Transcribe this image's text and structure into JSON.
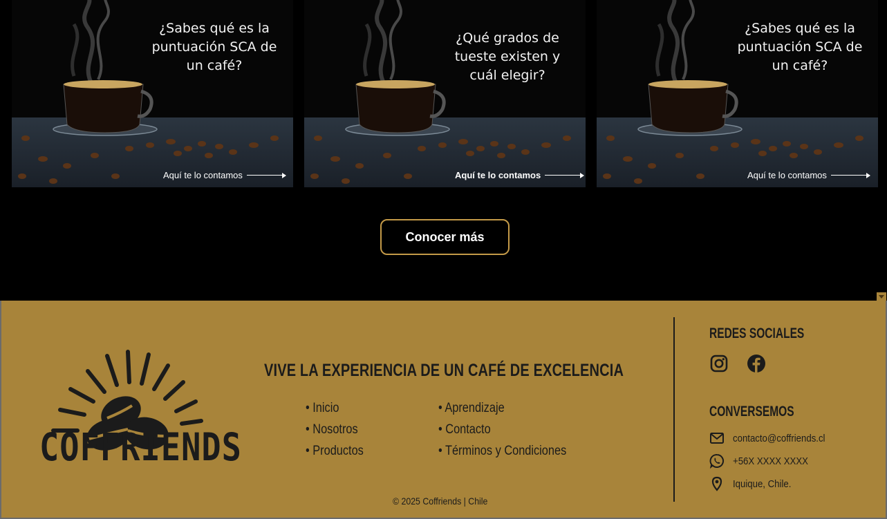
{
  "cards": [
    {
      "title": "¿Sabes qué es la\npuntuación SCA de\nun café?",
      "link": "Aquí te lo contamos"
    },
    {
      "title": "¿Qué grados de\ntueste existen y\ncuál elegir?",
      "link": "Aquí te lo contamos"
    },
    {
      "title": "¿Sabes qué es la\npuntuación SCA de\nun café?",
      "link": "Aquí te lo contamos"
    }
  ],
  "more_button": "Conocer más",
  "footer": {
    "logo_text": "COFFRIENDS",
    "tagline": "VIVE LA EXPERIENCIA DE UN CAFÉ DE EXCELENCIA",
    "nav_left": [
      "Inicio",
      "Nosotros",
      "Productos"
    ],
    "nav_right": [
      "Aprendizaje",
      "Contacto",
      "Términos y Condiciones"
    ],
    "copyright": "© 2025 Coffriends | Chile",
    "social_heading": "REDES SOCIALES",
    "social_icons": [
      "instagram-icon",
      "facebook-icon"
    ],
    "contact_heading": "CONVERSEMOS",
    "email": "contacto@coffriends.cl",
    "phone": "+56X XXXX XXXX",
    "location": "Iquique, Chile."
  },
  "colors": {
    "background_top": "#000000",
    "footer_bg": "#a8843a",
    "button_border": "#c49a48",
    "text_dark": "#1b1b1b"
  }
}
